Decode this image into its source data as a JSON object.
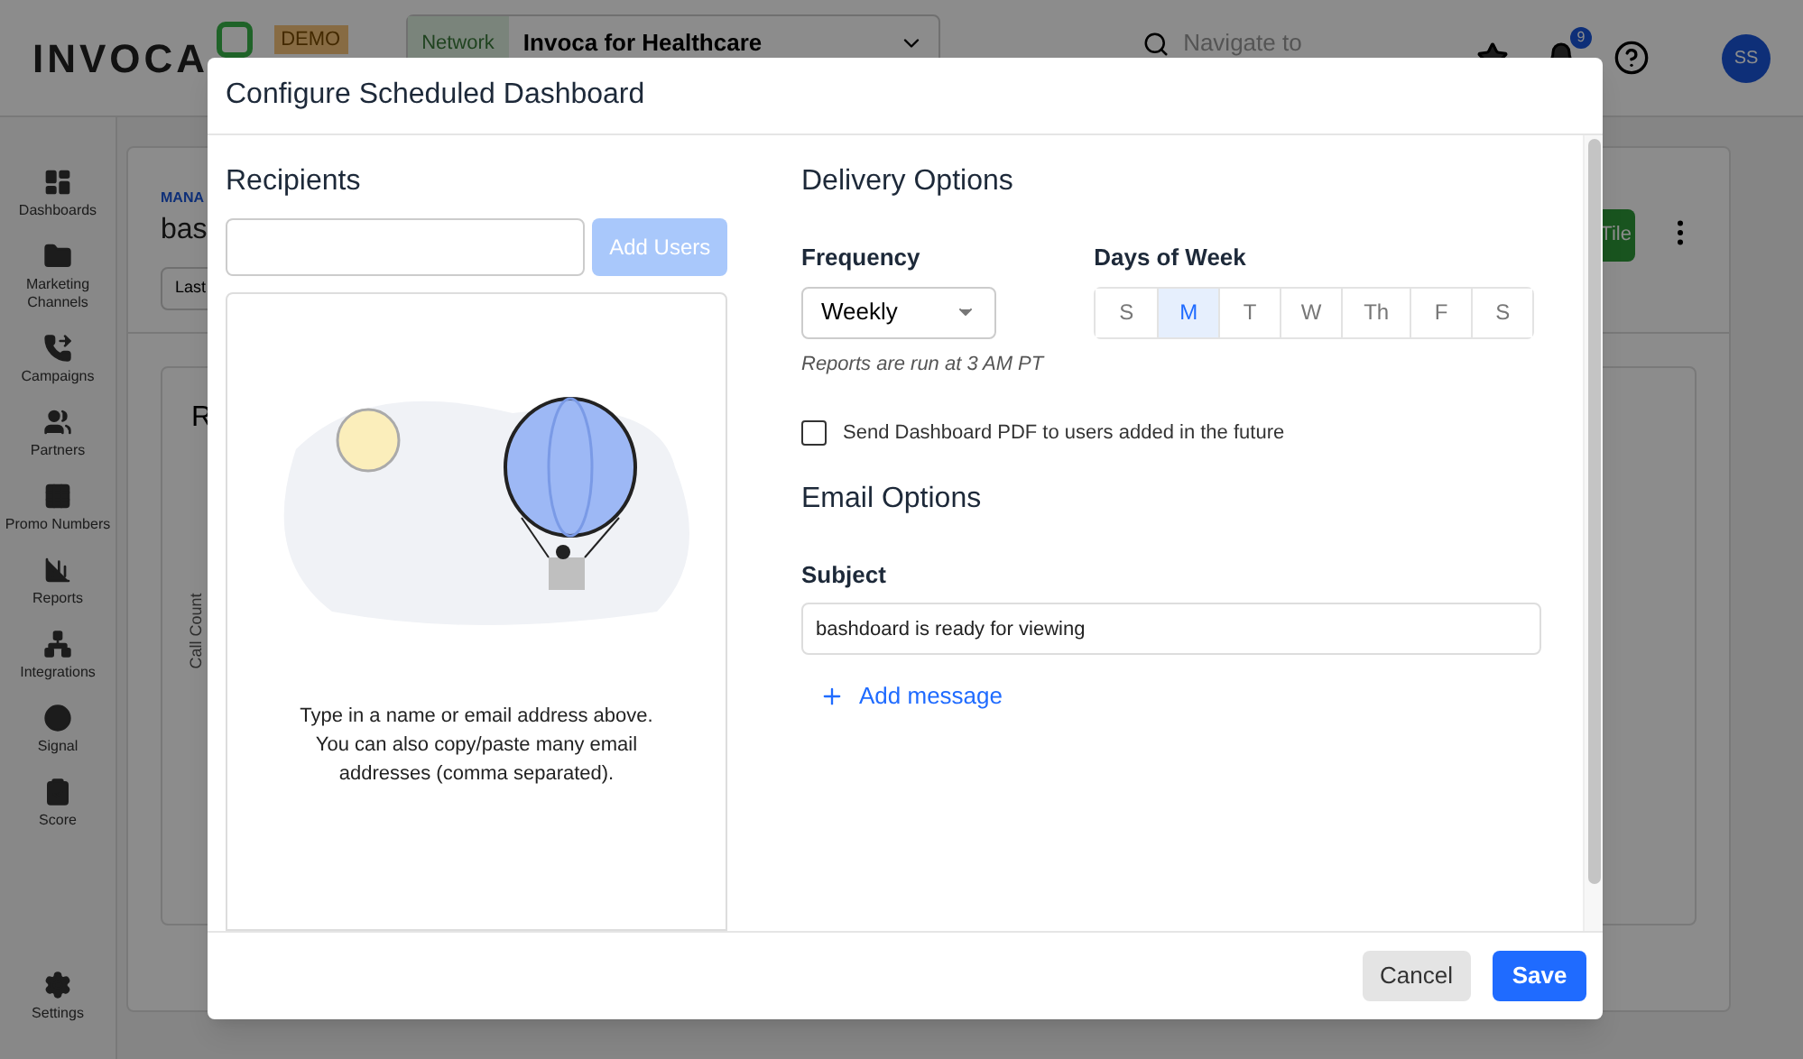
{
  "header": {
    "logo": "INVOCA",
    "demo_badge": "DEMO",
    "network_label": "Network",
    "network_value": "Invoca for Healthcare",
    "search_placeholder": "Navigate to",
    "notification_count": "9",
    "avatar_initials": "SS"
  },
  "sidebar": {
    "items": [
      {
        "label": "Dashboards"
      },
      {
        "label": "Marketing Channels"
      },
      {
        "label": "Campaigns"
      },
      {
        "label": "Partners"
      },
      {
        "label": "Promo Numbers"
      },
      {
        "label": "Reports"
      },
      {
        "label": "Integrations"
      },
      {
        "label": "Signal"
      },
      {
        "label": "Score"
      },
      {
        "label": "Settings"
      }
    ]
  },
  "page": {
    "breadcrumb": "MANA",
    "title": "bas",
    "date_filter": "Last",
    "add_tile_button": "Tile",
    "card_title": "R",
    "axis_label": "Call Count"
  },
  "dialog": {
    "title": "Configure Scheduled Dashboard",
    "recipients": {
      "heading": "Recipients",
      "add_button": "Add Users",
      "add_disabled": true,
      "empty_text": "Type in a name or email address above. You can also copy/paste many email addresses (comma separated)."
    },
    "delivery": {
      "heading": "Delivery Options",
      "frequency_label": "Frequency",
      "frequency_value": "Weekly",
      "frequency_note": "Reports are run at 3 AM PT",
      "days_label": "Days of Week",
      "days": [
        {
          "label": "S",
          "selected": false
        },
        {
          "label": "M",
          "selected": true
        },
        {
          "label": "T",
          "selected": false
        },
        {
          "label": "W",
          "selected": false
        },
        {
          "label": "Th",
          "selected": false
        },
        {
          "label": "F",
          "selected": false
        },
        {
          "label": "S",
          "selected": false
        }
      ],
      "future_users": {
        "label": "Send Dashboard PDF to users added in the future",
        "checked": false
      }
    },
    "email": {
      "heading": "Email Options",
      "subject_label": "Subject",
      "subject_value": "bashdoard is ready for viewing",
      "add_message": "Add message"
    },
    "buttons": {
      "cancel": "Cancel",
      "save": "Save"
    }
  }
}
